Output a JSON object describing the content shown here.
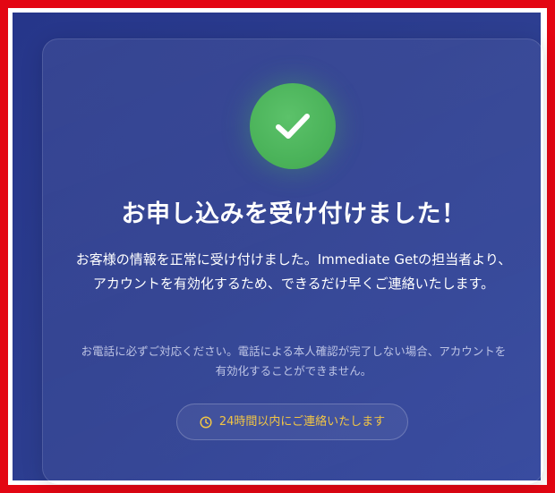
{
  "confirmation": {
    "title": "お申し込みを受け付けました！",
    "message": "お客様の情報を正常に受け付けました。Immediate Getの担当者より、アカウントを有効化するため、できるだけ早くご連絡いたします。",
    "note": "お電話に必ずご対応ください。電話による本人確認が完了しない場合、アカウントを有効化することができません。",
    "badge_text": "24時間以内にご連絡いたします"
  },
  "icons": {
    "success": "checkmark-icon",
    "badge": "clock-icon"
  },
  "colors": {
    "background": "#2c3d8f",
    "success_green": "#4bb35a",
    "badge_text": "#f2c544",
    "frame_red": "#e30613"
  }
}
